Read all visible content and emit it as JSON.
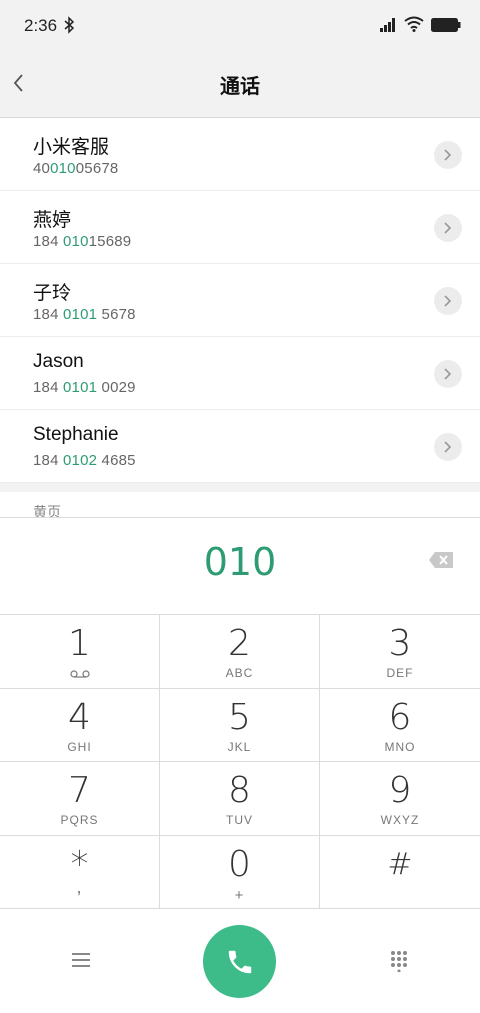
{
  "status_bar": {
    "time": "2:36"
  },
  "header": {
    "title": "通话"
  },
  "contacts": [
    {
      "name": "小米客服",
      "number_pre": "40",
      "number_match": "010",
      "number_post": "05678"
    },
    {
      "name": "燕婷",
      "number_pre": "184 ",
      "number_match": "010",
      "number_post": "15689"
    },
    {
      "name": "子玲",
      "number_pre": "184 ",
      "number_match": "0101",
      "number_post": " 5678"
    },
    {
      "name": "Jason",
      "number_pre": "184 ",
      "number_match": "0101",
      "number_post": " 0029"
    },
    {
      "name": "Stephanie",
      "number_pre": "184 ",
      "number_match": "0102",
      "number_post": " 4685"
    }
  ],
  "yellow_pages_label": "黄页",
  "dialed_number": "010",
  "keypad": [
    {
      "digit": "1",
      "letters": ""
    },
    {
      "digit": "2",
      "letters": "ABC"
    },
    {
      "digit": "3",
      "letters": "DEF"
    },
    {
      "digit": "4",
      "letters": "GHI"
    },
    {
      "digit": "5",
      "letters": "JKL"
    },
    {
      "digit": "6",
      "letters": "MNO"
    },
    {
      "digit": "7",
      "letters": "PQRS"
    },
    {
      "digit": "8",
      "letters": "TUV"
    },
    {
      "digit": "9",
      "letters": "WXYZ"
    },
    {
      "digit": "*",
      "letters": ","
    },
    {
      "digit": "0",
      "letters": "+"
    },
    {
      "digit": "#",
      "letters": ""
    }
  ],
  "colors": {
    "accent": "#2e9c73",
    "call_button": "#3dbc8a",
    "header_bg": "#f2f2f2"
  },
  "icons": {
    "back": "chevron-left-icon",
    "detail": "chevron-right-icon",
    "backspace": "backspace-icon",
    "call": "phone-icon",
    "menu": "menu-icon",
    "keypad_toggle": "dialpad-icon",
    "voicemail": "voicemail-icon"
  }
}
